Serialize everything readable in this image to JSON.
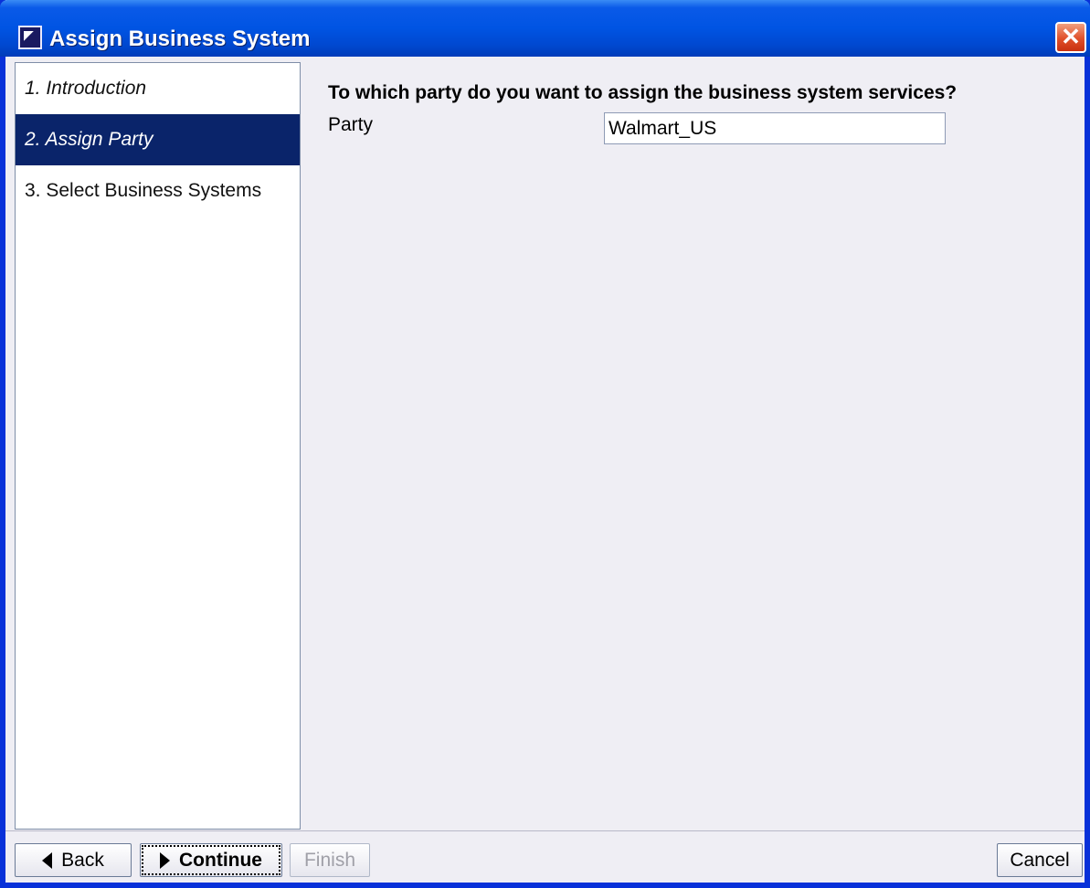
{
  "window": {
    "title": "Assign Business System",
    "close_symbol": "✕"
  },
  "steps": [
    {
      "label": "1. Introduction",
      "state": "done"
    },
    {
      "label": "2. Assign Party",
      "state": "active"
    },
    {
      "label": "3. Select Business Systems",
      "state": "pending"
    }
  ],
  "form": {
    "question": "To which party do you want to assign the business system services?",
    "party_label": "Party",
    "party_value": "Walmart_US"
  },
  "buttons": {
    "back": "Back",
    "continue": "Continue",
    "finish": "Finish",
    "cancel": "Cancel"
  },
  "icons": {
    "app": "app-window-icon",
    "close": "close-icon",
    "back": "triangle-left-icon",
    "continue": "triangle-right-icon"
  }
}
